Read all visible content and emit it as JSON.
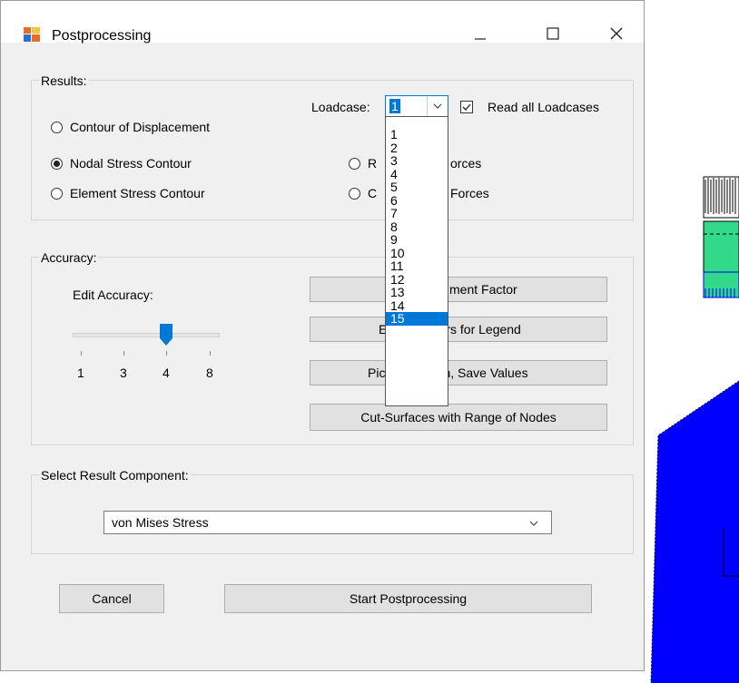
{
  "window": {
    "title": "Postprocessing"
  },
  "results": {
    "group_label": "Results:",
    "radio_displacement": "Contour of Displacement",
    "radio_nodal": "Nodal Stress Contour",
    "radio_element": "Element Stress Contour",
    "radio_reaction_visible": "R",
    "radio_reaction_tail": "orces",
    "radio_contact_visible": "C",
    "radio_contact_tail": "Forces",
    "loadcase_label": "Loadcase:",
    "loadcase_value": "1",
    "read_all_label": "Read all Loadcases",
    "read_all_checked": true
  },
  "loadcase_options": [
    "1",
    "2",
    "3",
    "4",
    "5",
    "6",
    "7",
    "8",
    "9",
    "10",
    "11",
    "12",
    "13",
    "14",
    "15"
  ],
  "loadcase_highlighted": "15",
  "accuracy": {
    "group_label": "Accuracy:",
    "edit_label": "Edit Accuracy:",
    "slider_ticks": [
      "1",
      "3",
      "4",
      "8"
    ],
    "slider_value": "4",
    "btn_enlargement_visible": "ment Factor",
    "btn_legend_visible": "E",
    "btn_legend_tail": "rs for Legend",
    "btn_pick_visible": "Pic",
    "btn_pick_tail": "n, Save Values",
    "btn_cut_surfaces": "Cut-Surfaces with Range of Nodes"
  },
  "component": {
    "group_label": "Select Result Component:",
    "selected": "von Mises Stress"
  },
  "footer": {
    "cancel_label": "Cancel",
    "start_label": "Start Postprocessing"
  },
  "colors": {
    "mesh_blue": "#0000ff",
    "mesh_green": "#33d98a",
    "selection_blue": "#0078d7"
  }
}
